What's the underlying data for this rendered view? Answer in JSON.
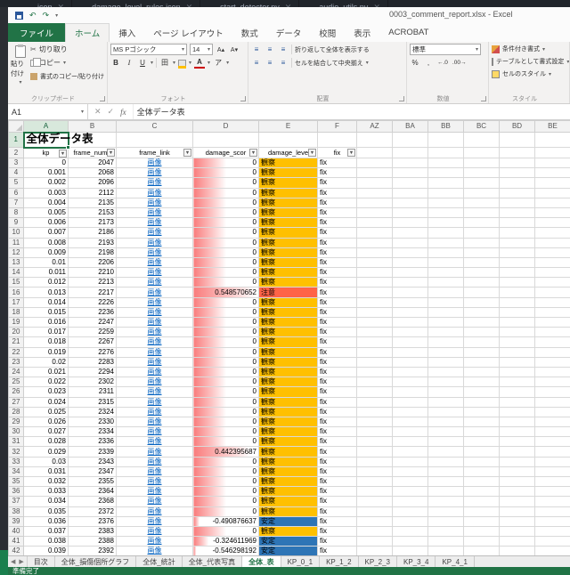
{
  "vscode": {
    "tabs": [
      "icon",
      "damage_level_rules.icon",
      "start_detector.py",
      "audio_utils.py"
    ]
  },
  "window": {
    "title": "0003_comment_report.xlsx - Excel"
  },
  "ribbon": {
    "file_tab": "ファイル",
    "tabs": [
      "ホーム",
      "挿入",
      "ページ レイアウト",
      "数式",
      "データ",
      "校閲",
      "表示",
      "ACROBAT"
    ],
    "active_tab": "ホーム",
    "groups": {
      "clipboard": {
        "label": "クリップボード",
        "paste": "貼り付け",
        "cut": "切り取り",
        "copy": "コピー",
        "format_painter": "書式のコピー/貼り付け"
      },
      "font": {
        "label": "フォント",
        "name": "MS Pゴシック",
        "size": "14",
        "bold": "B",
        "italic": "I",
        "underline": "U",
        "color_letter": "A",
        "ruby": "ア"
      },
      "alignment": {
        "label": "配置",
        "wrap": "折り返して全体を表示する",
        "merge": "セルを結合して中央揃え"
      },
      "number": {
        "label": "数値",
        "format": "標準",
        "buttons": [
          "%",
          ",",
          "←.0",
          ".00→"
        ]
      },
      "styles": {
        "label": "スタイル",
        "conditional": "条件付き書式",
        "table": "テーブルとして書式設定",
        "cell": "セルのスタイル"
      }
    }
  },
  "formula_bar": {
    "name_box": "A1",
    "fx": "fx",
    "content": "全体データ表"
  },
  "grid": {
    "columns": [
      "A",
      "B",
      "C",
      "D",
      "E",
      "F",
      "AZ",
      "BA",
      "BB",
      "BC",
      "BD",
      "BE"
    ],
    "selected_column": "A",
    "selected_row": "1",
    "title": "全体データ表",
    "headers": [
      "kp",
      "frame_numb",
      "frame_link",
      "damage_scor",
      "damage_leve",
      "fix"
    ],
    "link_text": "画像",
    "fix_text": "fix",
    "rows": [
      {
        "kp": "0",
        "frame": "2047",
        "score": "0",
        "level": "観察"
      },
      {
        "kp": "0.001",
        "frame": "2068",
        "score": "0",
        "level": "観察"
      },
      {
        "kp": "0.002",
        "frame": "2096",
        "score": "0",
        "level": "観察"
      },
      {
        "kp": "0.003",
        "frame": "2112",
        "score": "0",
        "level": "観察"
      },
      {
        "kp": "0.004",
        "frame": "2135",
        "score": "0",
        "level": "観察"
      },
      {
        "kp": "0.005",
        "frame": "2153",
        "score": "0",
        "level": "観察"
      },
      {
        "kp": "0.006",
        "frame": "2173",
        "score": "0",
        "level": "観察"
      },
      {
        "kp": "0.007",
        "frame": "2186",
        "score": "0",
        "level": "観察"
      },
      {
        "kp": "0.008",
        "frame": "2193",
        "score": "0",
        "level": "観察"
      },
      {
        "kp": "0.009",
        "frame": "2198",
        "score": "0",
        "level": "観察"
      },
      {
        "kp": "0.01",
        "frame": "2206",
        "score": "0",
        "level": "観察"
      },
      {
        "kp": "0.011",
        "frame": "2210",
        "score": "0",
        "level": "観察"
      },
      {
        "kp": "0.012",
        "frame": "2213",
        "score": "0",
        "level": "観察"
      },
      {
        "kp": "0.013",
        "frame": "2217",
        "score": "0.548570652",
        "level": "注意"
      },
      {
        "kp": "0.014",
        "frame": "2226",
        "score": "0",
        "level": "観察"
      },
      {
        "kp": "0.015",
        "frame": "2236",
        "score": "0",
        "level": "観察"
      },
      {
        "kp": "0.016",
        "frame": "2247",
        "score": "0",
        "level": "観察"
      },
      {
        "kp": "0.017",
        "frame": "2259",
        "score": "0",
        "level": "観察"
      },
      {
        "kp": "0.018",
        "frame": "2267",
        "score": "0",
        "level": "観察"
      },
      {
        "kp": "0.019",
        "frame": "2276",
        "score": "0",
        "level": "観察"
      },
      {
        "kp": "0.02",
        "frame": "2283",
        "score": "0",
        "level": "観察"
      },
      {
        "kp": "0.021",
        "frame": "2294",
        "score": "0",
        "level": "観察"
      },
      {
        "kp": "0.022",
        "frame": "2302",
        "score": "0",
        "level": "観察"
      },
      {
        "kp": "0.023",
        "frame": "2311",
        "score": "0",
        "level": "観察"
      },
      {
        "kp": "0.024",
        "frame": "2315",
        "score": "0",
        "level": "観察"
      },
      {
        "kp": "0.025",
        "frame": "2324",
        "score": "0",
        "level": "観察"
      },
      {
        "kp": "0.026",
        "frame": "2330",
        "score": "0",
        "level": "観察"
      },
      {
        "kp": "0.027",
        "frame": "2334",
        "score": "0",
        "level": "観察"
      },
      {
        "kp": "0.028",
        "frame": "2336",
        "score": "0",
        "level": "観察"
      },
      {
        "kp": "0.029",
        "frame": "2339",
        "score": "0.442395687",
        "level": "観察"
      },
      {
        "kp": "0.03",
        "frame": "2343",
        "score": "0",
        "level": "観察"
      },
      {
        "kp": "0.031",
        "frame": "2347",
        "score": "0",
        "level": "観察"
      },
      {
        "kp": "0.032",
        "frame": "2355",
        "score": "0",
        "level": "観察"
      },
      {
        "kp": "0.033",
        "frame": "2364",
        "score": "0",
        "level": "観察"
      },
      {
        "kp": "0.034",
        "frame": "2368",
        "score": "0",
        "level": "観察"
      },
      {
        "kp": "0.035",
        "frame": "2372",
        "score": "0",
        "level": "観察"
      },
      {
        "kp": "0.036",
        "frame": "2376",
        "score": "-0.490876637",
        "level": "安定"
      },
      {
        "kp": "0.037",
        "frame": "2383",
        "score": "0",
        "level": "観察"
      },
      {
        "kp": "0.038",
        "frame": "2388",
        "score": "-0.324611969",
        "level": "安定"
      },
      {
        "kp": "0.039",
        "frame": "2392",
        "score": "-0.546298192",
        "level": "安定"
      }
    ]
  },
  "sheet_tabs": {
    "tabs": [
      "目次",
      "全体_損傷個所グラフ",
      "全体_統計",
      "全体_代表写真",
      "全体_表",
      "KP_0_1",
      "KP_1_2",
      "KP_2_3",
      "KP_3_4",
      "KP_4_1"
    ],
    "active": "全体_表"
  },
  "status_bar": {
    "ready": "準備完了"
  },
  "icons": {
    "filter": "▼",
    "dropdown": "▾",
    "nav_left": "◀",
    "nav_right": "▶",
    "check": "✓",
    "cross": "✕",
    "cut": "✂",
    "undo": "↶",
    "redo": "↷",
    "align": "≡",
    "borders": "田",
    "grow_font": "A▴",
    "shrink_font": "A▾"
  },
  "colors": {
    "excel_green": "#217346",
    "link": "#0563c1",
    "level_観察": "#ffc000",
    "level_注意": "#ff6347",
    "level_安定": "#2e75b6",
    "bar_red": "#f97c7c"
  }
}
